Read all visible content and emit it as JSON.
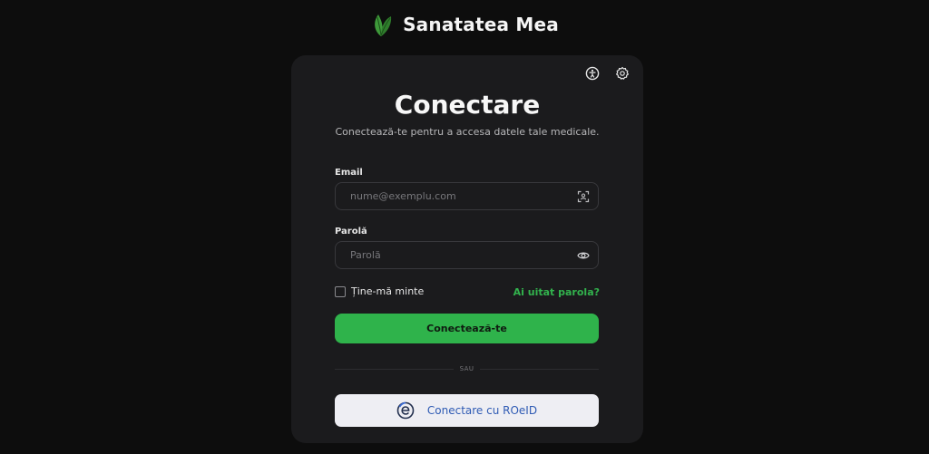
{
  "brand": {
    "name": "Sanatatea Mea",
    "logo_icon": "leaf-icon",
    "accent": "#2fb34b"
  },
  "card": {
    "tools": [
      "accessibility-icon",
      "gear-icon"
    ],
    "title": "Conectare",
    "subtitle": "Conectează-te pentru a accesa datele tale medicale."
  },
  "form": {
    "email": {
      "label": "Email",
      "placeholder": "nume@exemplu.com",
      "icon": "scan-icon"
    },
    "password": {
      "label": "Parolă",
      "placeholder": "Parolă",
      "icon": "eye-icon"
    },
    "remember_label": "Ține-mă minte",
    "forgot_label": "Ai uitat parola?",
    "submit_label": "Conectează-te",
    "divider_text": "SAU",
    "roeid_label": "Conectare cu ROeID",
    "roeid_icon": "roeid-logo-icon"
  }
}
